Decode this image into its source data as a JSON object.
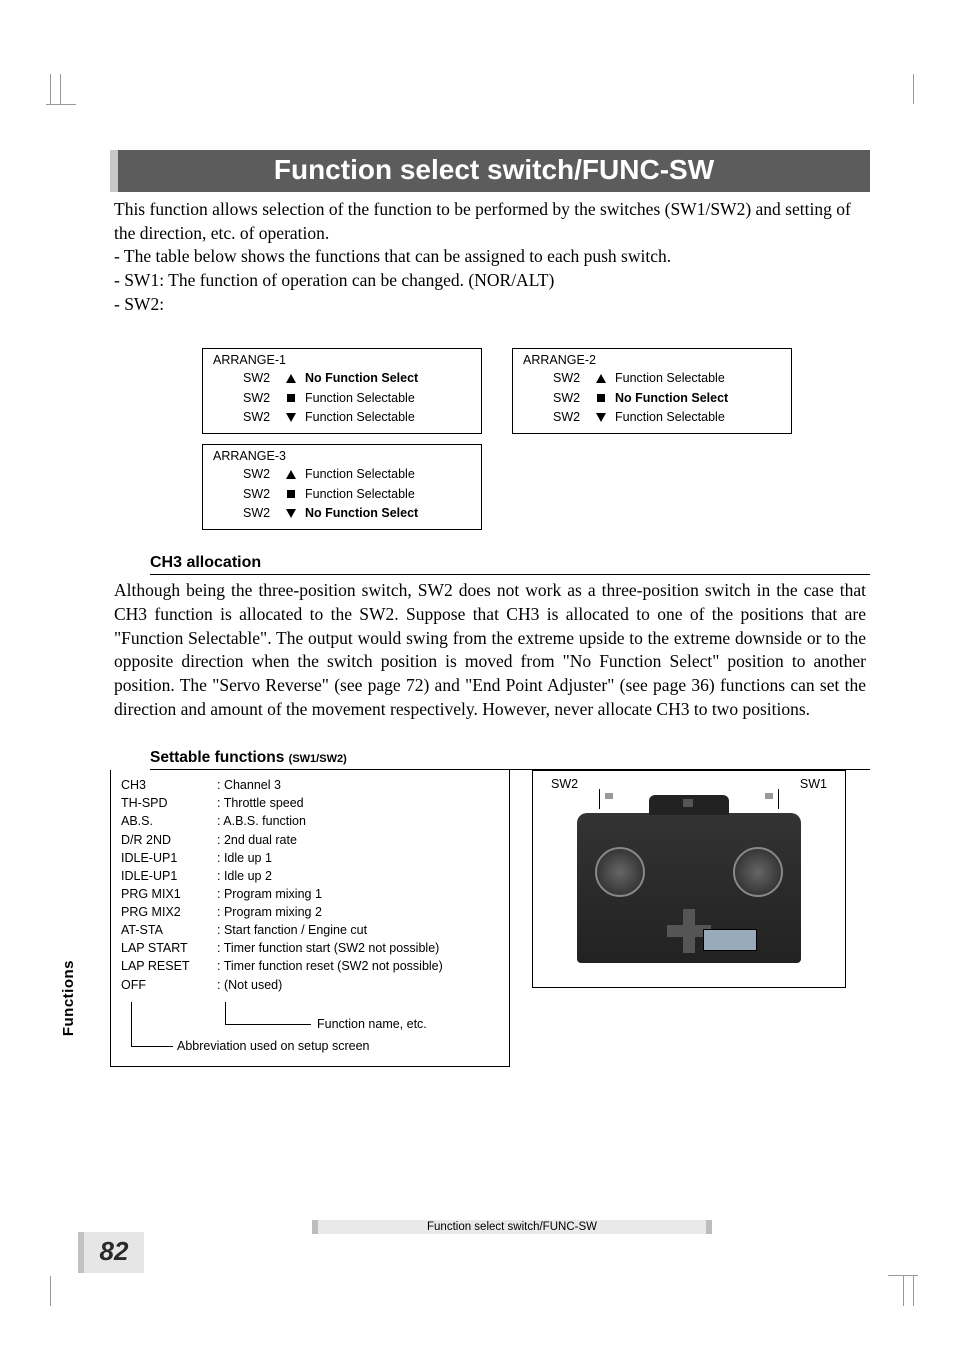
{
  "title": "Function select switch/FUNC-SW",
  "intro": [
    "This function allows selection of the function to be performed by the  switches (SW1/SW2) and setting of the direction, etc. of operation.",
    "- The table below shows the functions that can be assigned to each push switch.",
    "- SW1: The function of operation can be changed. (NOR/ALT)",
    "- SW2:"
  ],
  "arrange": [
    {
      "title": "ARRANGE-1",
      "rows": [
        {
          "sw": "SW2",
          "shape": "up",
          "text": "No Function Select",
          "bold": true
        },
        {
          "sw": "SW2",
          "shape": "sq",
          "text": "Function Selectable",
          "bold": false
        },
        {
          "sw": "SW2",
          "shape": "down",
          "text": "Function Selectable",
          "bold": false
        }
      ]
    },
    {
      "title": "ARRANGE-2",
      "rows": [
        {
          "sw": "SW2",
          "shape": "up",
          "text": "Function Selectable",
          "bold": false
        },
        {
          "sw": "SW2",
          "shape": "sq",
          "text": "No Function Select",
          "bold": true
        },
        {
          "sw": "SW2",
          "shape": "down",
          "text": "Function Selectable",
          "bold": false
        }
      ]
    },
    {
      "title": "ARRANGE-3",
      "rows": [
        {
          "sw": "SW2",
          "shape": "up",
          "text": "Function Selectable",
          "bold": false
        },
        {
          "sw": "SW2",
          "shape": "sq",
          "text": "Function Selectable",
          "bold": false
        },
        {
          "sw": "SW2",
          "shape": "down",
          "text": "No Function Select",
          "bold": true
        }
      ]
    }
  ],
  "ch3": {
    "heading": "CH3 allocation",
    "body": "Although being the three-position switch, SW2 does not work as a three-position switch in the case that CH3 function is allocated to the SW2. Suppose that CH3 is allocated to one of the positions that are \"Function Selectable\". The output would swing from the extreme upside to the extreme downside or to the opposite direction when the switch position is moved from \"No Function Select\" position to another position. The \"Servo Reverse\" (see page 72) and \"End Point Adjuster\" (see page 36) functions can set the direction and amount of the movement respectively. However, never allocate CH3 to two positions."
  },
  "settable": {
    "heading": "Settable functions",
    "heading_suffix": "(SW1/SW2)",
    "items": [
      {
        "abbr": "CH3",
        "desc": ": Channel 3"
      },
      {
        "abbr": "TH-SPD",
        "desc": ": Throttle speed"
      },
      {
        "abbr": "AB.S.",
        "desc": ": A.B.S. function"
      },
      {
        "abbr": "D/R 2ND",
        "desc": ": 2nd dual rate"
      },
      {
        "abbr": "IDLE-UP1",
        "desc": ": Idle up 1"
      },
      {
        "abbr": "IDLE-UP1",
        "desc": ": Idle up 2"
      },
      {
        "abbr": "PRG MIX1",
        "desc": ": Program mixing 1"
      },
      {
        "abbr": "PRG MIX2",
        "desc": ": Program mixing 2"
      },
      {
        "abbr": "AT-STA",
        "desc": ": Start fanction / Engine cut"
      },
      {
        "abbr": "LAP START",
        "desc": ": Timer function start (SW2 not possible)"
      },
      {
        "abbr": "LAP RESET",
        "desc": ": Timer function reset (SW2 not possible)"
      },
      {
        "abbr": "OFF",
        "desc": ": (Not used)"
      }
    ],
    "legend_right": "Function name, etc.",
    "legend_left": "Abbreviation used on setup screen"
  },
  "diagram": {
    "sw2": "SW2",
    "sw1": "SW1"
  },
  "footer": "Function select switch/FUNC-SW",
  "side_tab": "Functions",
  "page_number": "82"
}
